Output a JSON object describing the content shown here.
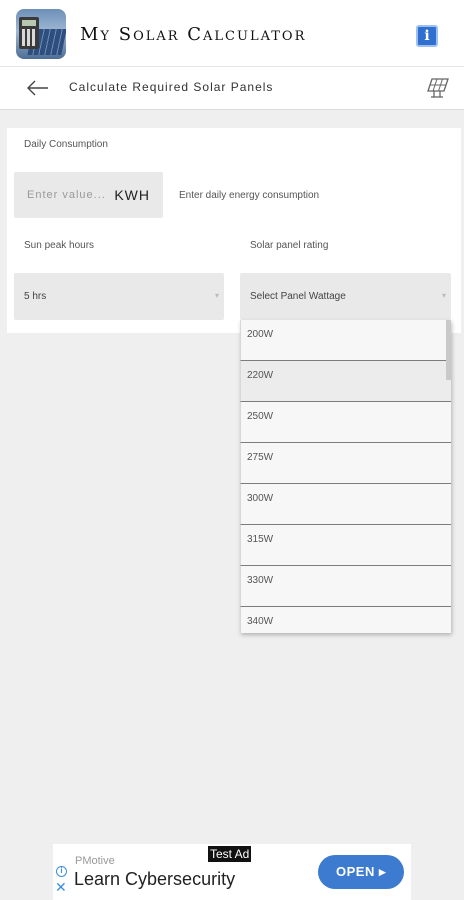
{
  "app": {
    "title": "My Solar Calculator",
    "logo_icon": "solar-calculator-logo-icon",
    "info_icon": "info-icon",
    "info_glyph": "i"
  },
  "subheader": {
    "back_icon": "back-arrow-icon",
    "title": "Calculate Required Solar Panels",
    "panel_icon": "solar-panel-icon"
  },
  "form": {
    "daily_consumption_label": "Daily Consumption",
    "daily_input_placeholder": "Enter value...",
    "daily_unit": "KWH",
    "daily_hint": "Enter daily energy consumption",
    "sun_peak_label": "Sun peak hours",
    "sun_peak_value": "5 hrs",
    "panel_rating_label": "Solar panel rating",
    "panel_rating_value": "Select Panel Wattage",
    "dropdown_arrow": "▾"
  },
  "dropdown": {
    "options": [
      "200W",
      "220W",
      "250W",
      "275W",
      "300W",
      "315W",
      "330W",
      "340W"
    ]
  },
  "ad": {
    "tag": "Test Ad",
    "advertiser": "PMotive",
    "headline": "Learn Cybersecurity",
    "cta": "OPEN ▸",
    "info_glyph": "i",
    "close_glyph": "✕"
  },
  "colors": {
    "accent_blue": "#3d7bd0",
    "info_blue": "#2f6fd0",
    "background": "#efefef",
    "field_bg": "#e9e9e9"
  }
}
